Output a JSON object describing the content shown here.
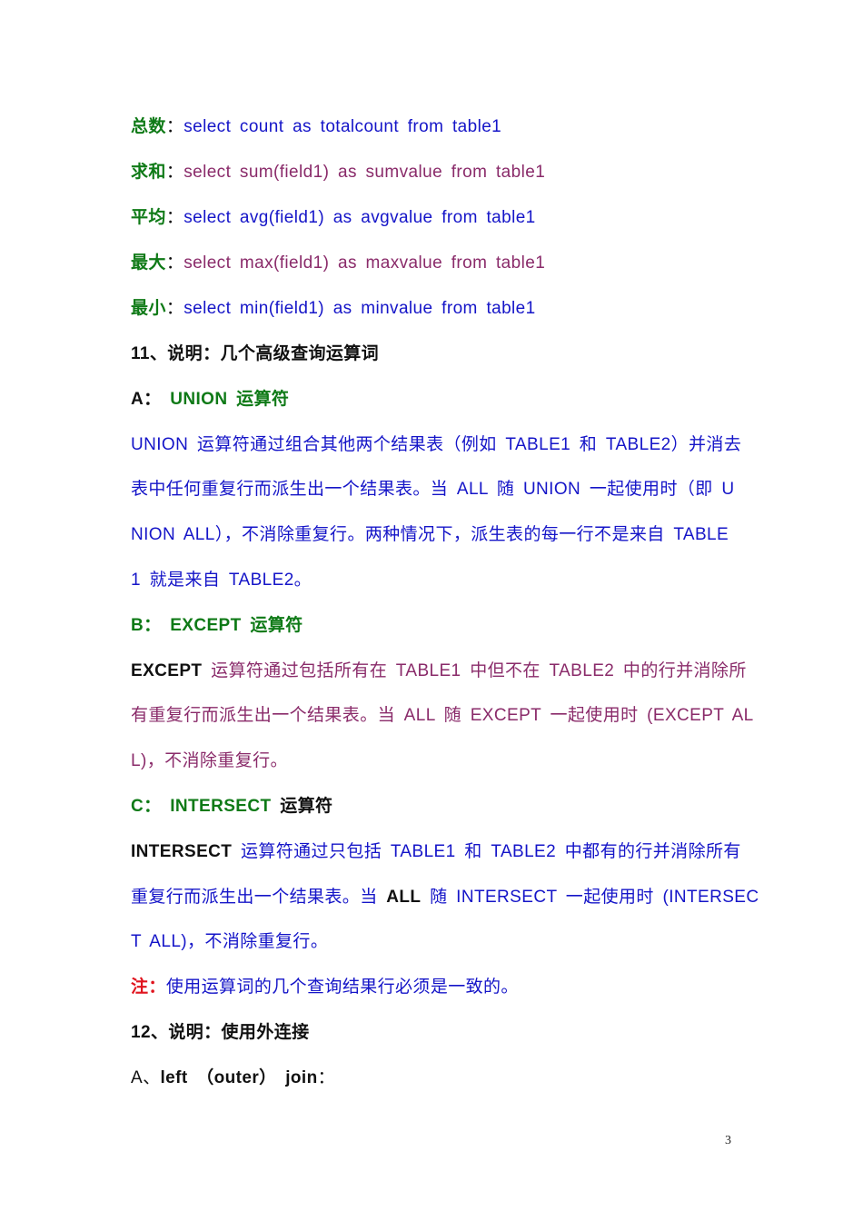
{
  "agg": [
    {
      "label": "总数",
      "sep": "：",
      "sql": "select count as totalcount from table1",
      "color": "blue"
    },
    {
      "label": "求和",
      "sep": "：",
      "sql": "select sum(field1) as sumvalue from table1",
      "color": "purple"
    },
    {
      "label": "平均",
      "sep": "：",
      "sql": "select avg(field1) as avgvalue from table1",
      "color": "blue"
    },
    {
      "label": "最大",
      "sep": "：",
      "sql": "select max(field1) as maxvalue from table1",
      "color": "purple"
    },
    {
      "label": "最小",
      "sep": "：",
      "sql": "select min(field1) as minvalue from table1",
      "color": "blue"
    }
  ],
  "section11": {
    "heading": "11、说明：几个高级查询运算词"
  },
  "union": {
    "prefix": "A：",
    "title": "UNION 运算符",
    "lines": [
      "UNION 运算符通过组合其他两个结果表（例如 TABLE1 和 TABLE2）并消去",
      "表中任何重复行而派生出一个结果表。当 ALL 随 UNION 一起使用时（即 U",
      "NION ALL），不消除重复行。两种情况下，派生表的每一行不是来自 TABLE",
      "1 就是来自 TABLE2。"
    ]
  },
  "except": {
    "prefix": "B：",
    "title": "EXCEPT 运算符",
    "keyword": "EXCEPT",
    "line1_rest": " 运算符通过包括所有在 TABLE1 中但不在 TABLE2 中的行并消除所",
    "lines": [
      "有重复行而派生出一个结果表。当 ALL 随 EXCEPT 一起使用时 (EXCEPT AL",
      "L)，不消除重复行。"
    ]
  },
  "intersect": {
    "prefix": "C：",
    "title_en": "INTERSECT",
    "title_zh": "运算符",
    "keyword": "INTERSECT",
    "line1_rest": " 运算符通过只包括 TABLE1 和 TABLE2 中都有的行并消除所有",
    "line2_a": "重复行而派生出一个结果表。当 ",
    "line2_bold": "ALL",
    "line2_b": " 随 INTERSECT 一起使用时 (INTERSEC",
    "line3": "T ALL)，不消除重复行。"
  },
  "note": {
    "label": "注：",
    "text": "使用运算词的几个查询结果行必须是一致的。"
  },
  "section12": {
    "heading": "12、说明：使用外连接"
  },
  "leftjoin": {
    "prefix": "A、",
    "text": "left （outer） join",
    "suffix": "："
  },
  "page_number": "3"
}
